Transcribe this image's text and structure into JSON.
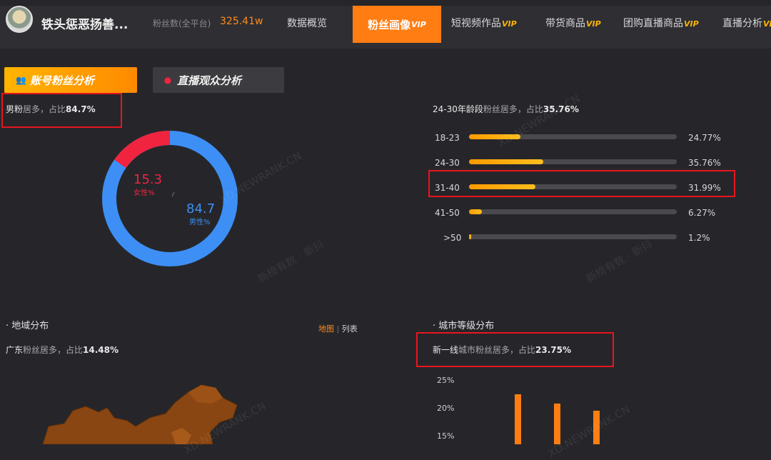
{
  "header": {
    "username": "铁头惩恶扬善...",
    "fans_label": "粉丝数(全平台)",
    "fans_value": "325.41w",
    "nav": [
      {
        "label": "数据概览",
        "vip": ""
      },
      {
        "label": "粉丝画像",
        "vip": "VIP"
      },
      {
        "label": "短视频作品",
        "vip": "VIP"
      },
      {
        "label": "带货商品",
        "vip": "VIP"
      },
      {
        "label": "团购直播商品",
        "vip": "VIP"
      },
      {
        "label": "直播分析",
        "vip": "VIP"
      }
    ]
  },
  "tabs": {
    "account": "账号粉丝分析",
    "live": "直播观众分析"
  },
  "gender": {
    "summary_prefix": "男粉",
    "summary_mid": "居多，占比",
    "summary_value": "84.7%",
    "female_value": "15.3",
    "female_label": "女性%",
    "male_value": "84.7",
    "male_label": "男性%",
    "female_color": "#f0243f",
    "male_color": "#3d8ff5"
  },
  "age": {
    "summary_prefix": "24-30年龄段",
    "summary_mid": "粉丝居多，占比",
    "summary_value": "35.76%",
    "rows": [
      {
        "label": "18-23",
        "value": "24.77%",
        "pct": 24.77
      },
      {
        "label": "24-30",
        "value": "35.76%",
        "pct": 35.76
      },
      {
        "label": "31-40",
        "value": "31.99%",
        "pct": 31.99
      },
      {
        "label": "41-50",
        "value": "6.27%",
        "pct": 6.27
      },
      {
        "label": ">50",
        "value": "1.2%",
        "pct": 1.2
      }
    ]
  },
  "region": {
    "title": "地域分布",
    "toggle_map": "地图",
    "toggle_list": "列表",
    "summary_prefix": "广东",
    "summary_mid": "粉丝居多，占比",
    "summary_value": "14.48%"
  },
  "city": {
    "title": "城市等级分布",
    "summary_prefix": "新一线",
    "summary_mid": "城市粉丝居多，占比",
    "summary_value": "23.75%",
    "yticks": [
      "25%",
      "20%",
      "15%"
    ],
    "bars": [
      23.75,
      22.1,
      20.8
    ]
  },
  "watermarks": [
    "XD.NEWRANK.CN",
    "新榜有数 · 新抖"
  ]
}
